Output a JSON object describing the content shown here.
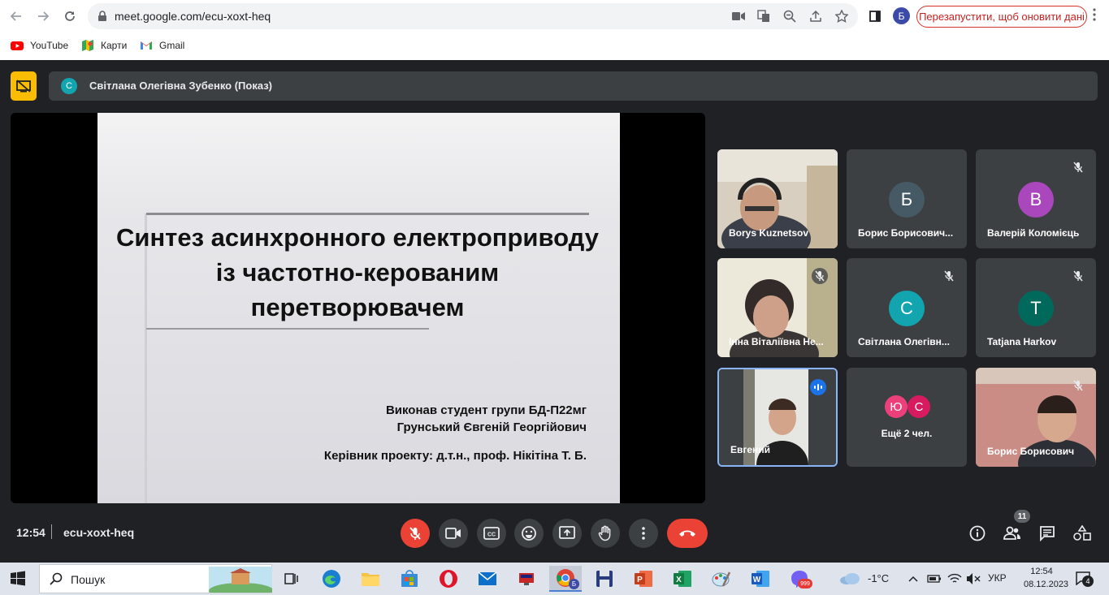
{
  "browser": {
    "url": "meet.google.com/ecu-xoxt-heq",
    "profile_initial": "Б",
    "relaunch_label": "Перезапустити, щоб оновити дані",
    "bookmarks": [
      {
        "label": "YouTube",
        "icon": "youtube-icon"
      },
      {
        "label": "Карти",
        "icon": "maps-icon"
      },
      {
        "label": "Gmail",
        "icon": "gmail-icon"
      }
    ]
  },
  "meet": {
    "presenter": {
      "initial": "С",
      "name": "Світлана Олегівна Зубенко (Показ)"
    },
    "slide": {
      "title": "Синтез асинхронного електроприводу із частотно-керованим перетворювачем",
      "author_line1": "Виконав студент групи БД-П22мг",
      "author_line2": "Грунський Євгеній Георгійович",
      "supervisor": "Керівник проекту: д.т.н., проф. Нікітіна Т. Б."
    },
    "participants": [
      {
        "name": "Borys Kuznetsov",
        "initial": "",
        "color": "",
        "video": true,
        "muted": false
      },
      {
        "name": "Борис Борисович...",
        "initial": "Б",
        "color": "#455a64",
        "video": false,
        "muted": false
      },
      {
        "name": "Валерій Коломієць",
        "initial": "В",
        "color": "#ab47bc",
        "video": false,
        "muted": true
      },
      {
        "name": "Інна Віталіївна Не...",
        "initial": "",
        "color": "",
        "video": true,
        "muted": true
      },
      {
        "name": "Світлана Олегівн...",
        "initial": "С",
        "color": "#12a4af",
        "video": false,
        "muted": true
      },
      {
        "name": "Tatjana Harkov",
        "initial": "Т",
        "color": "#00695c",
        "video": false,
        "muted": true
      },
      {
        "name": "Евгений",
        "initial": "",
        "color": "",
        "video": true,
        "muted": false,
        "speaking": true
      },
      {
        "name": "Ещё 2 чел.",
        "initials": [
          "Ю",
          "С"
        ],
        "colors": [
          "#ec407a",
          "#d81b60"
        ]
      },
      {
        "name": "Борис Борисович",
        "initial": "",
        "color": "",
        "video": true,
        "muted": true
      }
    ],
    "clock": "12:54",
    "meeting_code": "ecu-xoxt-heq",
    "people_count": "11",
    "accent_red": "#ea4335",
    "accent_blue": "#8ab4f8"
  },
  "taskbar": {
    "search_placeholder": "Пошук",
    "weather": "-1°C",
    "language": "УКР",
    "time": "12:54",
    "date": "08.12.2023",
    "notifications": "4",
    "viber_badge": "999",
    "chrome_profile_badge": "Б"
  }
}
